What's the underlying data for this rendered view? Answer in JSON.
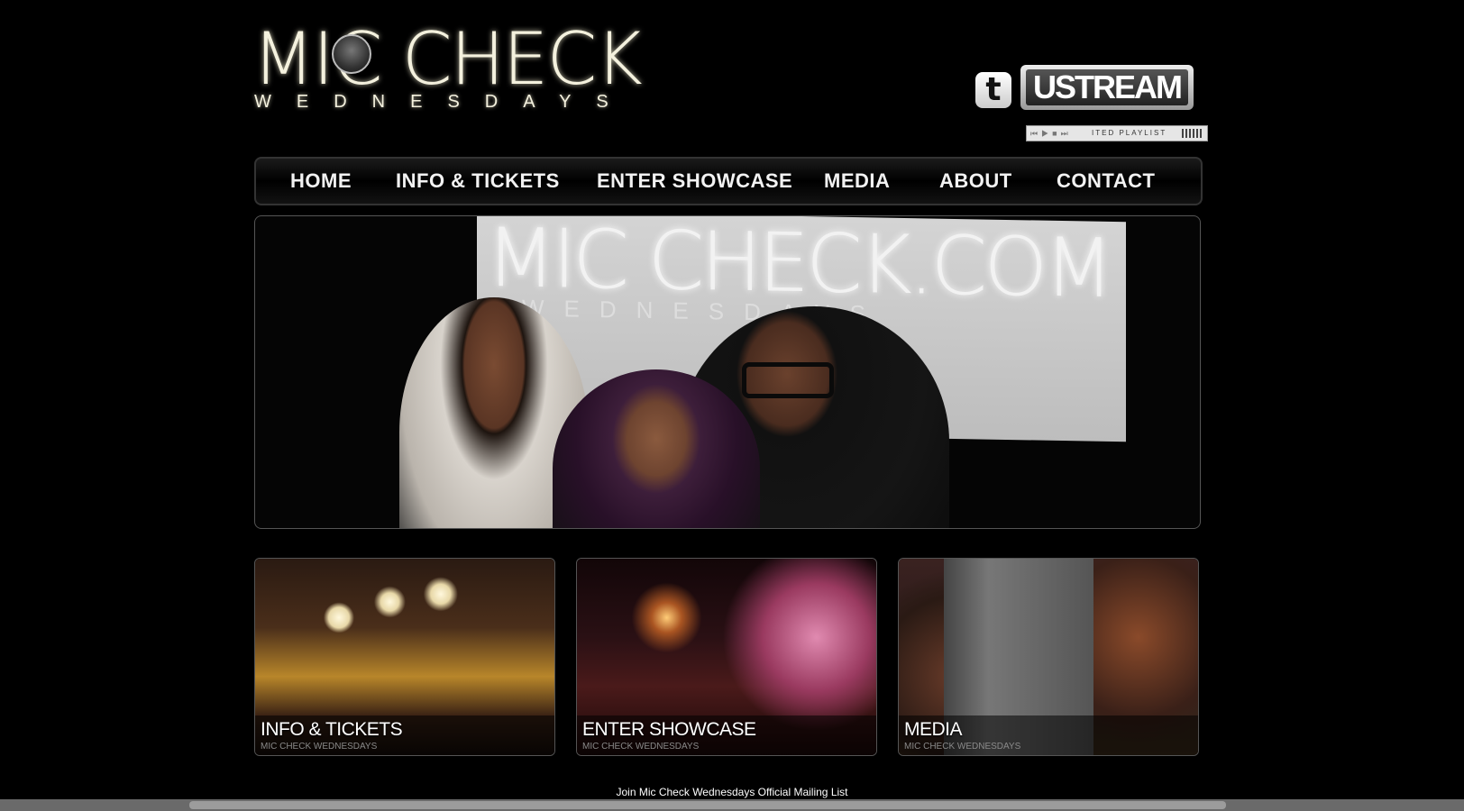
{
  "logo": {
    "main": "MIC CHECK",
    "sub": "WEDNESDAYS"
  },
  "social": {
    "twitter_icon": "twitter-icon",
    "ustream_label": "USTREAM",
    "player_label": "ITED PLAYLIST",
    "player_controls": "⏮▶■⏭"
  },
  "nav": {
    "items": [
      {
        "label": "HOME"
      },
      {
        "label": "INFO & TICKETS"
      },
      {
        "label": "ENTER SHOWCASE"
      },
      {
        "label": "MEDIA"
      },
      {
        "label": "ABOUT"
      },
      {
        "label": "CONTACT"
      }
    ]
  },
  "hero": {
    "screen_text": "MIC CHECK.COM",
    "screen_sub": "WEDNESDAYS"
  },
  "tiles": [
    {
      "title": "INFO & TICKETS",
      "subtitle": "MIC CHECK WEDNESDAYS"
    },
    {
      "title": "ENTER SHOWCASE",
      "subtitle": "MIC CHECK WEDNESDAYS"
    },
    {
      "title": "MEDIA",
      "subtitle": "MIC CHECK WEDNESDAYS"
    }
  ],
  "footer": {
    "mailing_link": "Join Mic Check Wednesdays Official Mailing List"
  },
  "colors": {
    "background": "#000000",
    "logo_glow": "#f4f1de",
    "nav_text": "#f2f2f2"
  }
}
